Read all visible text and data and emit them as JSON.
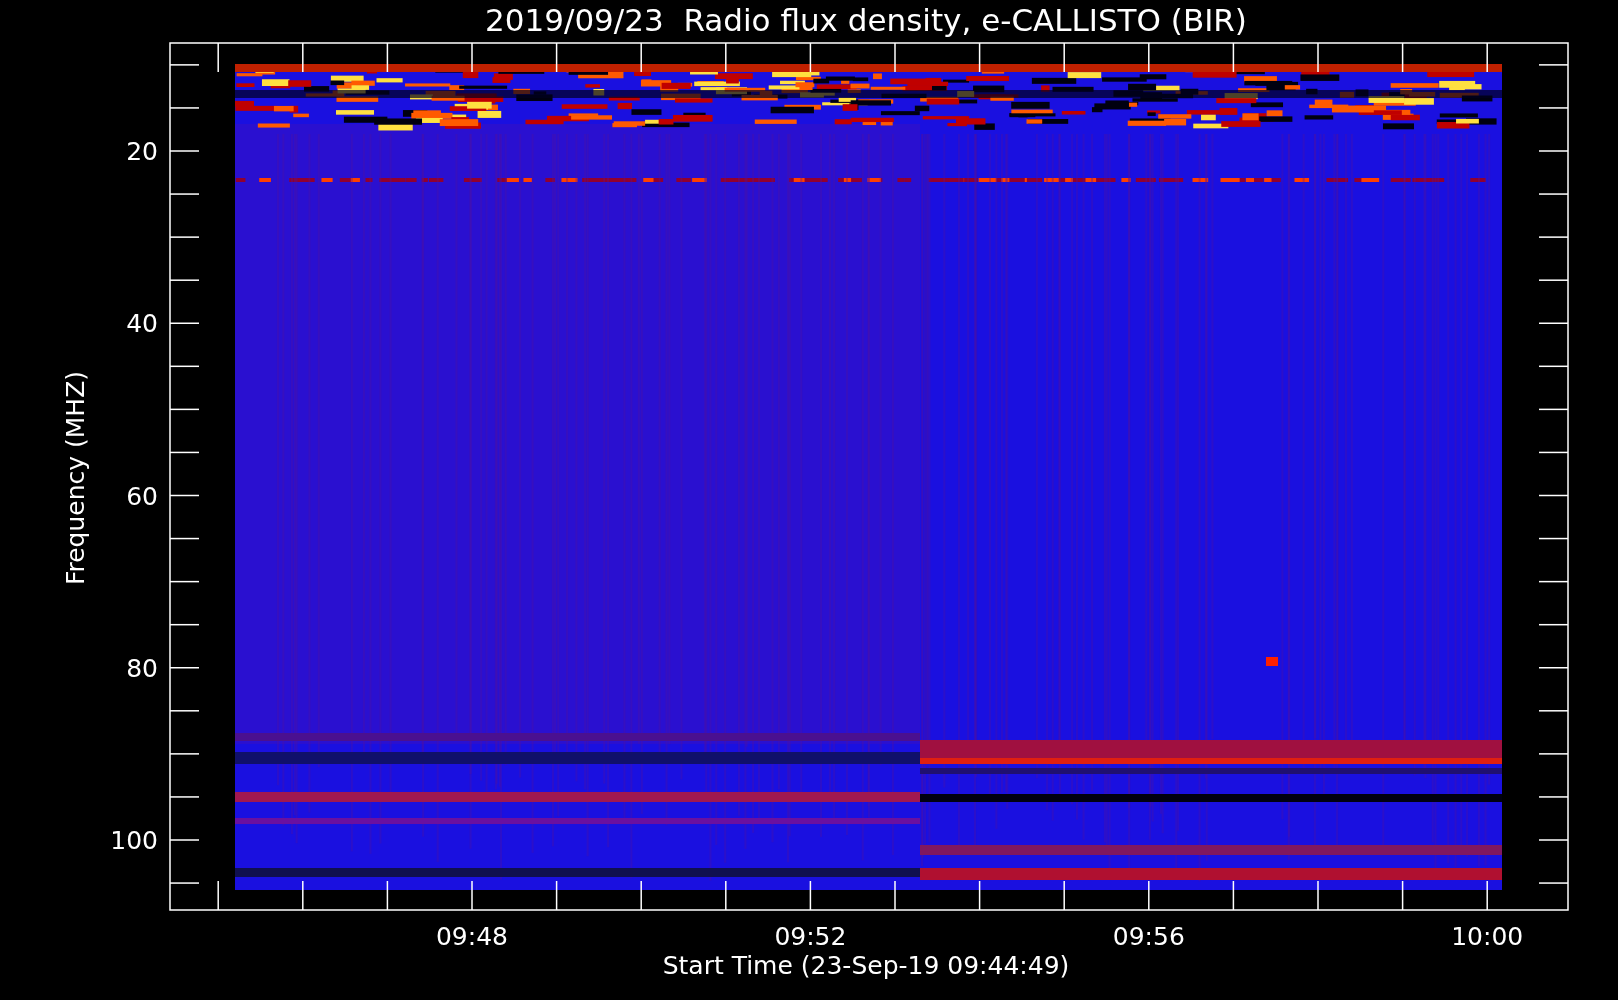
{
  "title": "2019/09/23  Radio flux density, e-CALLISTO (BIR)",
  "plot": {
    "ylabel": "Frequency (MHZ)",
    "xlabel": "Start Time (23-Sep-19 09:44:49)",
    "y_ticks": [
      "20",
      "40",
      "60",
      "80",
      "100"
    ],
    "x_ticks": [
      "09:48",
      "09:52",
      "09:56",
      "10:00"
    ]
  }
}
